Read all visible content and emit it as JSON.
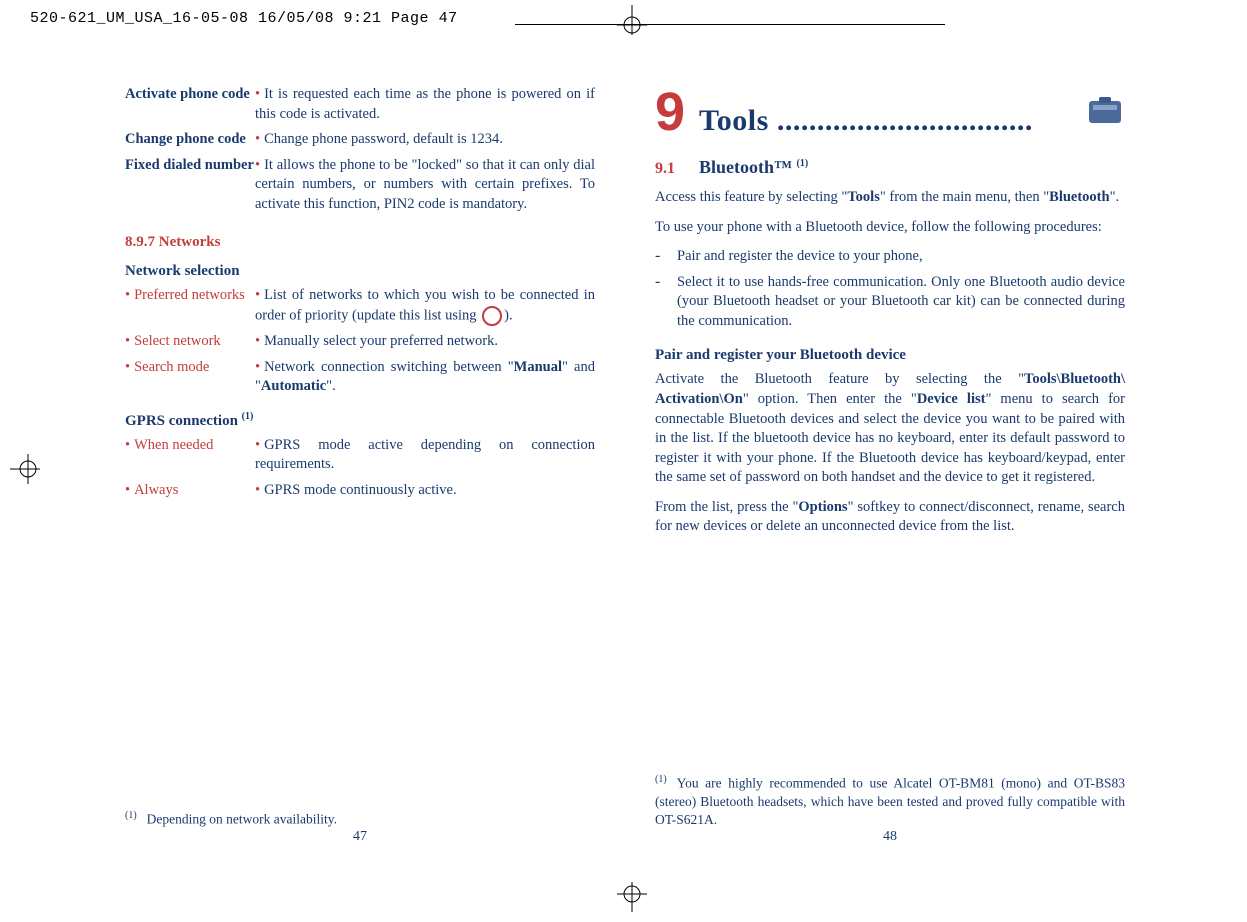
{
  "crop_header": "520-621_UM_USA_16-05-08  16/05/08  9:21  Page 47",
  "left_page": {
    "rows": [
      {
        "term_bold": "Activate phone code",
        "desc": "It is requested each time as the phone is powered on if this code is activated."
      },
      {
        "term_bold": "Change phone code",
        "desc": "Change phone password, default is 1234."
      },
      {
        "term_bold": "Fixed dialed number",
        "desc": "It allows the phone to be \"locked\" so that it can only dial certain numbers, or numbers with certain prefixes. To activate this function, PIN2 code is mandatory."
      }
    ],
    "sec_897": "8.9.7    Networks",
    "net_sel": "Network selection",
    "net_rows": [
      {
        "term": "Preferred networks",
        "desc_pre": "List of networks to which you wish to be connected in order of priority (update this list using ",
        "desc_post": ")."
      },
      {
        "term": "Select network",
        "desc": "Manually select your preferred network."
      },
      {
        "term": "Search mode",
        "desc_pre": "Network connection switching between \"",
        "b1": "Manual",
        "mid": "\" and \"",
        "b2": "Automatic",
        "desc_post": "\"."
      }
    ],
    "gprs_hd": "GPRS connection ",
    "gprs_sup": "(1)",
    "gprs_rows": [
      {
        "term": "When needed",
        "desc": "GPRS mode active depending on connection requirements."
      },
      {
        "term": "Always",
        "desc": "GPRS mode continuously active."
      }
    ],
    "foot_sup": "(1)",
    "foot_text": "Depending on network availability.",
    "page_num": "47"
  },
  "right_page": {
    "ch_num": "9",
    "ch_title": "Tools ................................",
    "sec_n": "9.1",
    "sec_t": "Bluetooth™ ",
    "sec_sup": "(1)",
    "p1_a": "Access this feature by selecting \"",
    "p1_b1": "Tools",
    "p1_b": "\" from the main menu, then \"",
    "p1_b2": "Bluetooth",
    "p1_c": "\".",
    "p2": "To use your phone with a Bluetooth device, follow the following procedures:",
    "li1": "Pair and register the device to your phone,",
    "li2": "Select it to use hands-free communication. Only one Bluetooth audio device (your Bluetooth headset or your Bluetooth car kit) can be connected during the communication.",
    "hd_pair": "Pair and register your Bluetooth device",
    "p3_a": "Activate the Bluetooth feature by selecting the \"",
    "p3_b1": "Tools\\Bluetooth\\ Activation\\On",
    "p3_b": "\" option.  Then enter the \"",
    "p3_b2": "Device list",
    "p3_c": "\" menu to search for connectable Bluetooth devices and select the device you want to be paired with in the list. If the bluetooth device has no keyboard, enter its default password to register it with your phone. If the Bluetooth device has keyboard/keypad, enter the same set of password on both handset and the device to get it registered.",
    "p4_a": "From the list, press the \"",
    "p4_b1": "Options",
    "p4_b": "\" softkey to connect/disconnect, rename, search for new devices or delete an unconnected device from the list.",
    "foot_sup": "(1)",
    "foot_text": "You are highly recommended to use Alcatel OT-BM81 (mono) and OT-BS83 (stereo) Bluetooth headsets, which have been tested and proved fully compatible with OT-S621A.",
    "page_num": "48"
  }
}
